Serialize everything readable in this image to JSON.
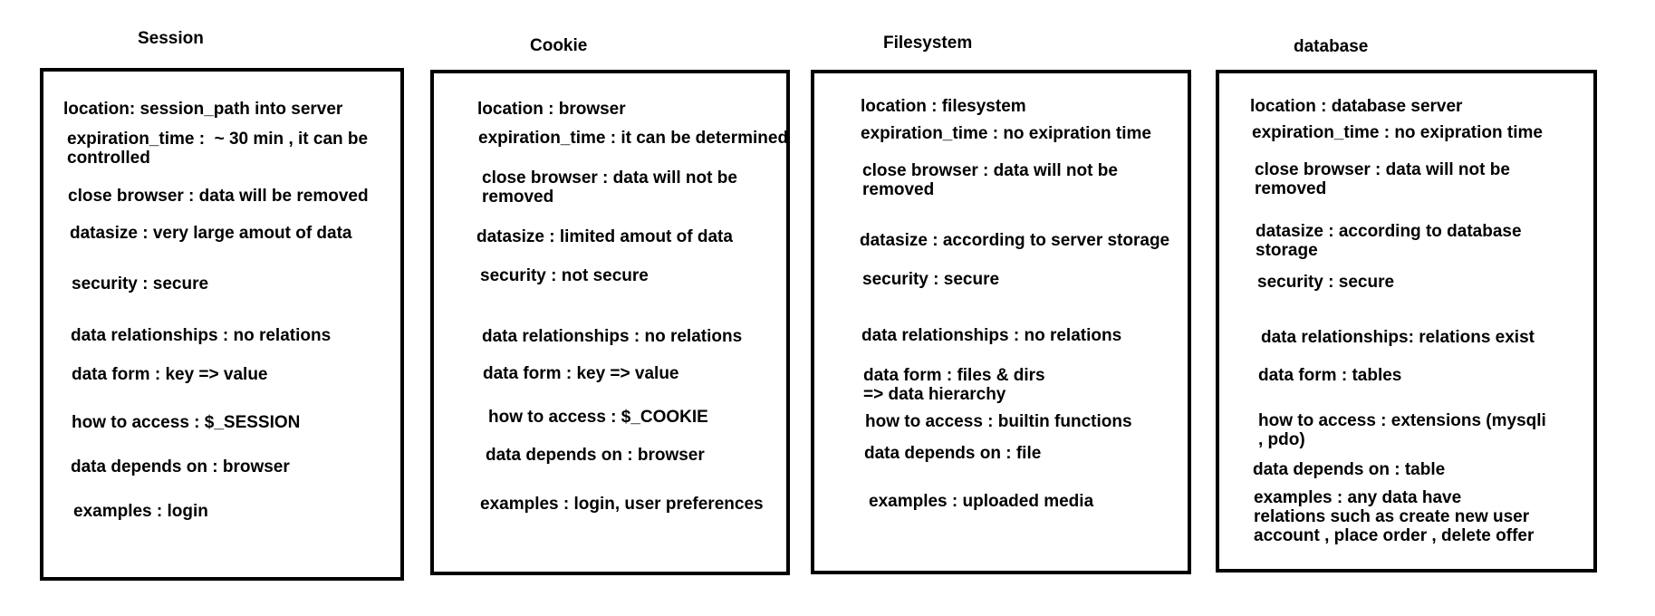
{
  "diagram": {
    "columns": [
      {
        "title": "Session",
        "items": [
          "location: session_path into server",
          "expiration_time :  ~ 30 min , it can be\ncontrolled",
          "close browser : data will be removed",
          "datasize : very large amout of data",
          "security : secure",
          "data relationships : no relations",
          "data form : key => value",
          "how to access : $_SESSION",
          "data depends on : browser",
          "examples : login"
        ]
      },
      {
        "title": "Cookie",
        "items": [
          "location : browser",
          "expiration_time : it can be determined",
          "close browser : data will not be\nremoved",
          "datasize : limited amout of data",
          "security : not secure",
          "data relationships : no relations",
          "data form : key => value",
          "how to access : $_COOKIE",
          "data depends on : browser",
          "examples : login, user preferences"
        ]
      },
      {
        "title": "Filesystem",
        "items": [
          "location : filesystem",
          "expiration_time : no exipration time",
          "close browser : data will not be\nremoved",
          "datasize : according to server storage",
          "security : secure",
          "data relationships : no relations",
          "data form : files & dirs\n=> data hierarchy",
          "how to access : builtin functions",
          "data depends on : file",
          "examples : uploaded media"
        ]
      },
      {
        "title": "database",
        "items": [
          "location : database server",
          "expiration_time : no exipration time",
          "close browser : data will not be\nremoved",
          "datasize : according to database\nstorage",
          "security : secure",
          "data relationships: relations exist",
          "data form : tables",
          "how to access : extensions (mysqli\n, pdo)",
          "data depends on : table",
          "examples : any data have\nrelations such as create new user\naccount , place order , delete offer"
        ]
      }
    ]
  }
}
